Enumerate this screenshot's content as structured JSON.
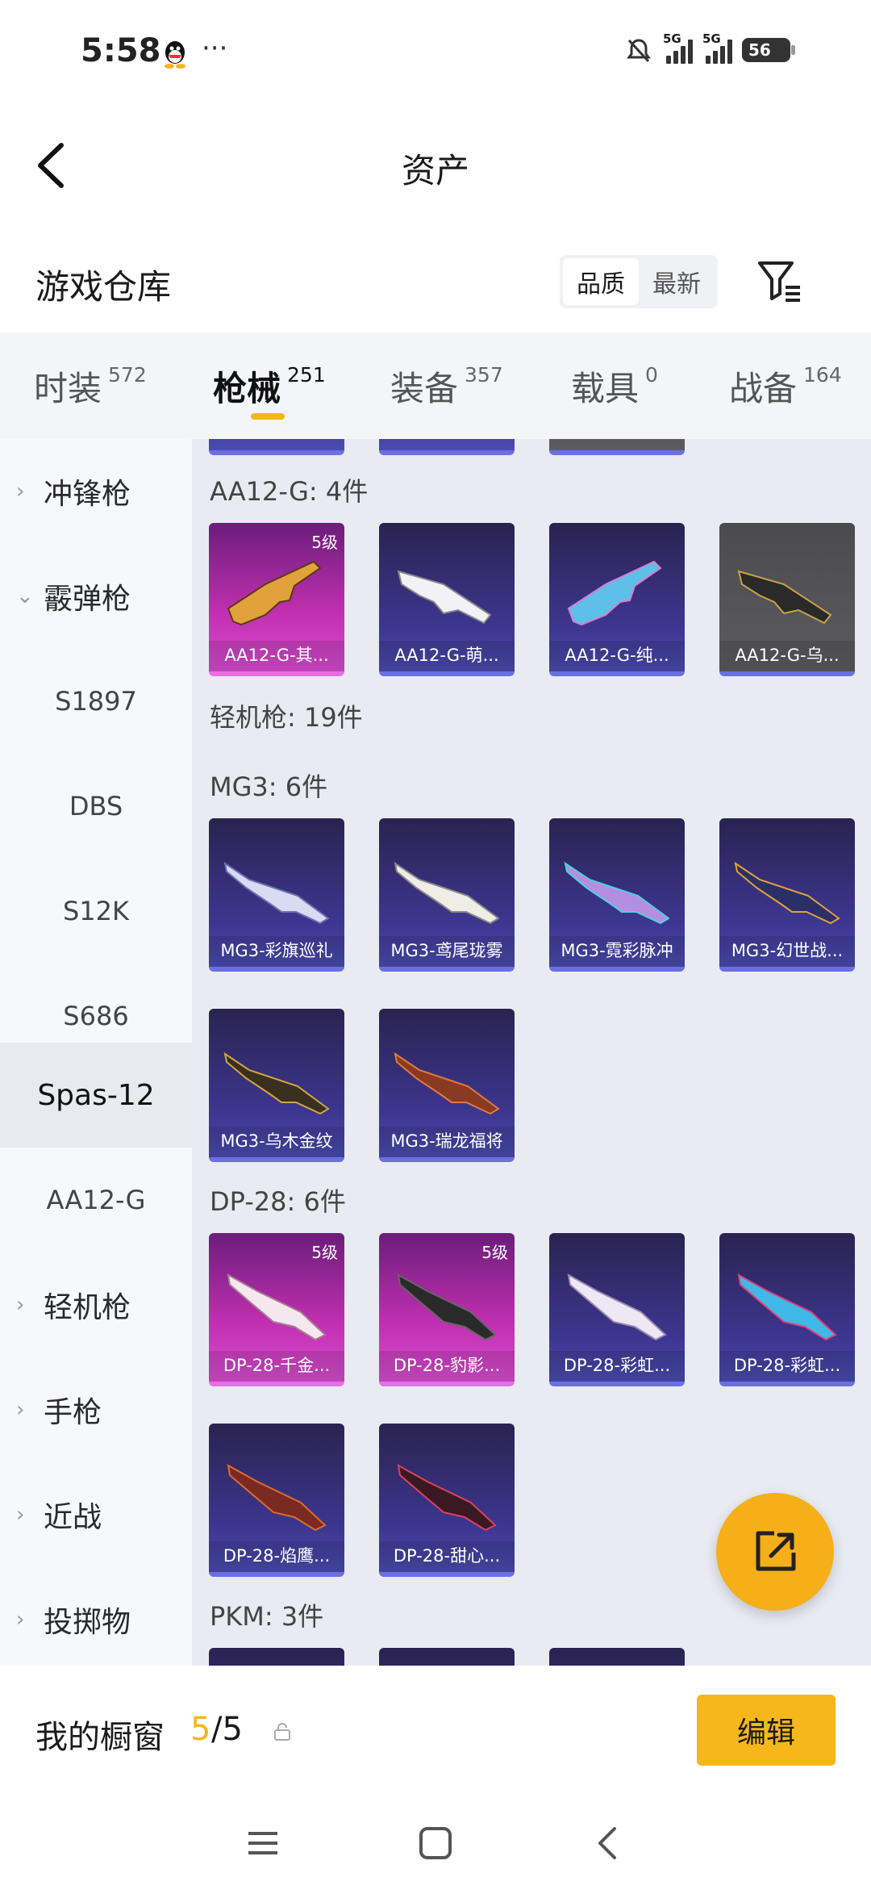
{
  "status_bar": {
    "time": "5:58",
    "more": "···",
    "network1": "5G",
    "network2": "5G",
    "battery": "56"
  },
  "header": {
    "title": "资产"
  },
  "section": {
    "title": "游戏仓库",
    "sort_options": [
      "品质",
      "最新"
    ]
  },
  "tabs": [
    {
      "label": "时装",
      "count": "572"
    },
    {
      "label": "枪械",
      "count": "251"
    },
    {
      "label": "装备",
      "count": "357"
    },
    {
      "label": "载具",
      "count": "0"
    },
    {
      "label": "战备",
      "count": "164"
    }
  ],
  "sidebar": {
    "items": [
      "冲锋枪",
      "霰弹枪",
      "S1897",
      "DBS",
      "S12K",
      "S686",
      "Spas-12",
      "AA12-G",
      "轻机枪",
      "手枪",
      "近战",
      "投掷物"
    ]
  },
  "content": {
    "group_aa12": "AA12-G: 4件",
    "lmg_header": "轻机枪: 19件",
    "group_mg3": "MG3: 6件",
    "group_dp28": "DP-28: 6件",
    "group_pkm": "PKM: 3件",
    "aa12_items": [
      "AA12-G-其...",
      "AA12-G-萌...",
      "AA12-G-纯...",
      "AA12-G-乌..."
    ],
    "mg3_items": [
      "MG3-彩旗巡礼",
      "MG3-鸢尾珑雾",
      "MG3-霓彩脉冲",
      "MG3-幻世战...",
      "MG3-乌木金纹",
      "MG3-瑞龙福将"
    ],
    "dp28_items": [
      "DP-28-千金...",
      "DP-28-豹影...",
      "DP-28-彩虹...",
      "DP-28-彩虹...",
      "DP-28-焰鹰...",
      "DP-28-甜心..."
    ],
    "level_badge": "5级"
  },
  "bottom": {
    "label": "我的橱窗",
    "count_current": "5",
    "count_total": "/5",
    "edit": "编辑"
  },
  "colors": {
    "accent": "#f5b71a",
    "card_purple": "#3d3690",
    "card_pink": "#c02fb0"
  }
}
